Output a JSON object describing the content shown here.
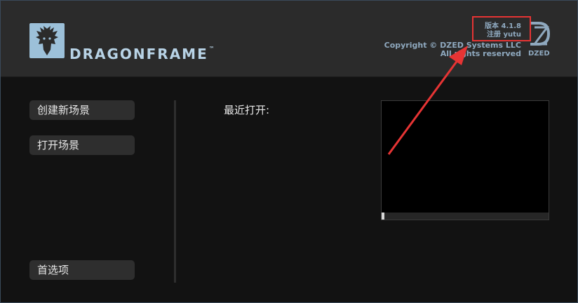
{
  "header": {
    "logo_text": "DRAGONFRAME",
    "logo_tm": "™",
    "version_line": "版本 4.1.8",
    "registered_line": "注册 yutu",
    "copyright_line1": "Copyright © DZED Systems LLC",
    "copyright_line2": "All rights reserved",
    "company_mark": "DZED"
  },
  "sidebar": {
    "new_scene_label": "创建新场景",
    "open_scene_label": "打开场景",
    "preferences_label": "首选项"
  },
  "main": {
    "recent_label": "最近打开:"
  },
  "annotation": {
    "highlight_color": "#e63434"
  },
  "colors": {
    "brand": "#9cc0d9",
    "background": "#121212",
    "header_bg": "#2b2b2b"
  }
}
